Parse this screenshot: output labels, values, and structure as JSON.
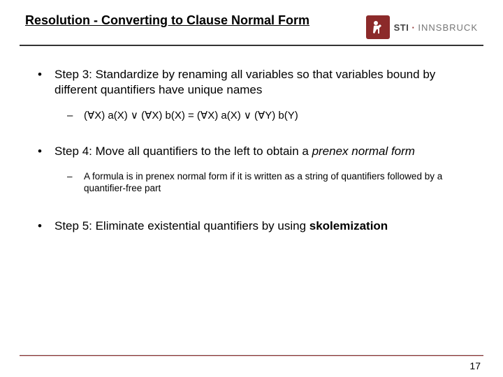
{
  "header": {
    "title": "Resolution - Converting to Clause Normal Form",
    "logo": {
      "sti": "STI",
      "dot": " · ",
      "inns": "INNSBRUCK"
    }
  },
  "content": {
    "step3": {
      "text_a": "Step 3: Standardize by renaming all variables so that variables bound by different quantifiers have unique names",
      "formula": "(∀X) a(X) ∨ (∀X) b(X) = (∀X) a(X) ∨ (∀Y) b(Y)"
    },
    "step4": {
      "text_a": "Step 4: Move all quantifiers to the left to obtain a ",
      "text_b": "prenex normal form",
      "sub": "A formula is in prenex normal form if it is written as a string of quantifiers followed by a quantifier-free part"
    },
    "step5": {
      "text_a": "Step 5: Eliminate existential quantifiers by using ",
      "text_b": "skolemization"
    }
  },
  "footer": {
    "page": "17"
  }
}
